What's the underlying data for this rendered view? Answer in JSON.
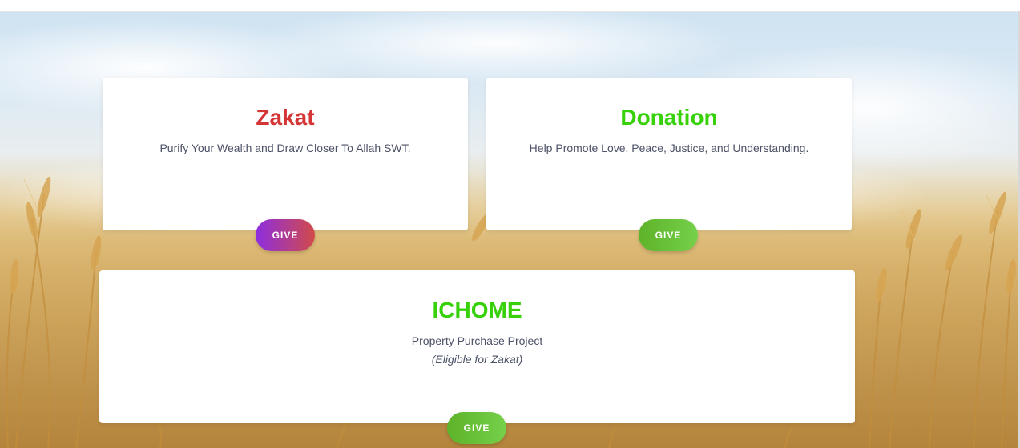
{
  "colors": {
    "zakat_title": "#d63535",
    "donation_title": "#37d10a",
    "ichome_title": "#37d10a",
    "description_text": "#4c5267",
    "give_zakat_gradient": [
      "#8d2ee0",
      "#d14a4a"
    ],
    "give_green_gradient": [
      "#5db32a",
      "#76d04a"
    ]
  },
  "cards": {
    "zakat": {
      "title": "Zakat",
      "description": "Purify Your Wealth and Draw Closer To Allah SWT.",
      "button_label": "GIVE"
    },
    "donation": {
      "title": "Donation",
      "description": "Help Promote Love, Peace, Justice, and Understanding.",
      "button_label": "GIVE"
    },
    "ichome": {
      "title": "ICHOME",
      "description": "Property Purchase Project",
      "note": "(Eligible for Zakat)",
      "button_label": "GIVE"
    }
  },
  "background": {
    "image": "wheat-field-background"
  }
}
